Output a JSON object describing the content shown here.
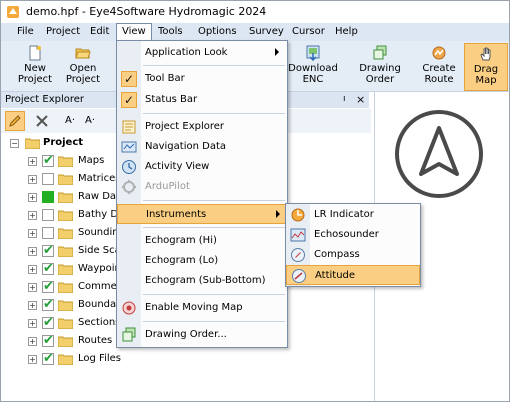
{
  "window": {
    "title": "demo.hpf - Eye4Software Hydromagic 2024"
  },
  "menubar": {
    "items": [
      "File",
      "Project",
      "Edit",
      "View",
      "Tools",
      "Options",
      "Survey",
      "Cursor",
      "Help"
    ],
    "open_item": "View"
  },
  "toolbar": {
    "new_project": {
      "line1": "New",
      "line2": "Project"
    },
    "open_project": {
      "line1": "Open",
      "line2": "Project"
    },
    "download_enc": {
      "line1": "Download",
      "line2": "ENC"
    },
    "drawing_order": {
      "line1": "Drawing",
      "line2": "Order"
    },
    "create_route": {
      "line1": "Create",
      "line2": "Route"
    },
    "drag_map": {
      "line1": "Drag",
      "line2": "Map"
    }
  },
  "explorer": {
    "title": "Project Explorer",
    "pin": "ı",
    "close": "×",
    "tools": [
      "A·",
      "A·"
    ],
    "root": "Project",
    "items": [
      {
        "label": "Maps",
        "checked": true,
        "filled": false
      },
      {
        "label": "Matrices",
        "checked": false,
        "filled": false
      },
      {
        "label": "Raw Dat",
        "checked": false,
        "filled": true
      },
      {
        "label": "Bathy Da",
        "checked": false,
        "filled": false
      },
      {
        "label": "Soundin",
        "checked": false,
        "filled": false
      },
      {
        "label": "Side Sca",
        "checked": true,
        "filled": false
      },
      {
        "label": "Waypoir",
        "checked": true,
        "filled": false
      },
      {
        "label": "Commer",
        "checked": true,
        "filled": false
      },
      {
        "label": "Boundar",
        "checked": true,
        "filled": false
      },
      {
        "label": "Sections",
        "checked": true,
        "filled": false
      },
      {
        "label": "Routes",
        "checked": true,
        "filled": false
      },
      {
        "label": "Log Files",
        "checked": true,
        "filled": false
      }
    ]
  },
  "view_menu": {
    "application_look": "Application Look",
    "tool_bar": "Tool Bar",
    "status_bar": "Status Bar",
    "project_explorer": "Project Explorer",
    "navigation_data": "Navigation Data",
    "activity_view": "Activity View",
    "ardupilot": "ArduPilot",
    "instruments": "Instruments",
    "echogram_hi": "Echogram (Hi)",
    "echogram_lo": "Echogram (Lo)",
    "echogram_sub": "Echogram (Sub-Bottom)",
    "enable_moving_map": "Enable Moving Map",
    "drawing_order": "Drawing Order...",
    "check": "✓"
  },
  "instruments_menu": {
    "lr_indicator": "LR Indicator",
    "echosounder": "Echosounder",
    "compass": "Compass",
    "attitude": "Attitude"
  },
  "colors": {
    "highlight": "#fbcf83",
    "menubar": "#dde7f3",
    "toolbar": "#e4ecf6",
    "check_green": "#26a036"
  }
}
